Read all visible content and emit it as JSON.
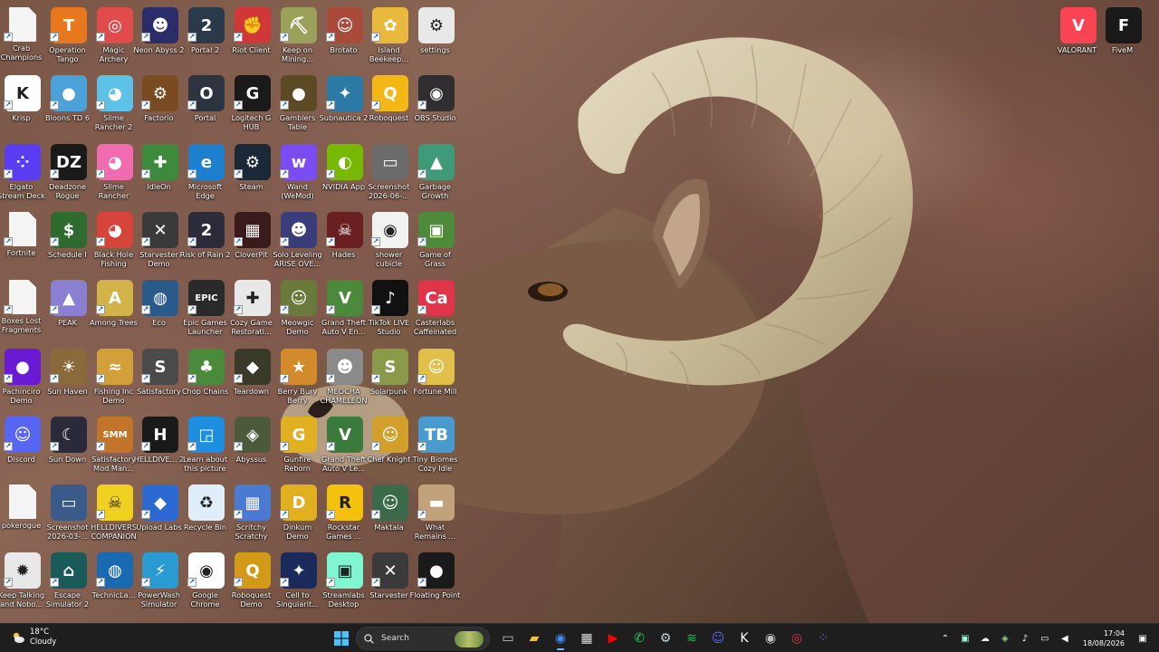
{
  "desktop_icons": [
    {
      "label": "Crab Champions",
      "icon": "file-icon",
      "bg": "file",
      "glyph": "",
      "shortcut": true
    },
    {
      "label": "Operation Tango",
      "icon": "operation-tango-icon",
      "bg": "#e8781e",
      "glyph": "T",
      "shortcut": true
    },
    {
      "label": "Magic Archery",
      "icon": "magic-archery-icon",
      "bg": "#e04b4b",
      "glyph": "◎",
      "shortcut": true
    },
    {
      "label": "Neon Abyss 2",
      "icon": "neon-abyss-icon",
      "bg": "#2b2d6b",
      "glyph": "☻",
      "shortcut": true
    },
    {
      "label": "Portal 2",
      "icon": "portal-2-icon",
      "bg": "#2a3a4a",
      "glyph": "2",
      "shortcut": true
    },
    {
      "label": "Riot Client",
      "icon": "riot-client-icon",
      "bg": "#d13639",
      "glyph": "✊",
      "shortcut": true
    },
    {
      "label": "Keep on Mining...",
      "icon": "keep-on-mining-icon",
      "bg": "#9aa15a",
      "glyph": "⛏",
      "shortcut": true
    },
    {
      "label": "Brotato",
      "icon": "brotato-icon",
      "bg": "#a94a3b",
      "glyph": "☺",
      "shortcut": true
    },
    {
      "label": "Island Beekeep...",
      "icon": "island-beekeeper-icon",
      "bg": "#e9b93d",
      "glyph": "✿",
      "shortcut": true
    },
    {
      "label": "settings",
      "icon": "settings-file-icon",
      "bg": "#e8e8e8",
      "glyph": "⚙",
      "shortcut": false
    },
    {
      "label": "Krisp",
      "icon": "krisp-icon",
      "bg": "#ffffff",
      "glyph": "K",
      "shortcut": true
    },
    {
      "label": "Bloons TD 6",
      "icon": "bloons-icon",
      "bg": "#4aa2d8",
      "glyph": "●",
      "shortcut": true
    },
    {
      "label": "Slime Rancher 2",
      "icon": "slime-rancher-2-icon",
      "bg": "#5ec1e7",
      "glyph": "◕",
      "shortcut": true
    },
    {
      "label": "Factorio",
      "icon": "factorio-icon",
      "bg": "#7a4a20",
      "glyph": "⚙",
      "shortcut": true
    },
    {
      "label": "Portal",
      "icon": "portal-icon",
      "bg": "#2c3440",
      "glyph": "O",
      "shortcut": true
    },
    {
      "label": "Logitech G HUB",
      "icon": "logitech-icon",
      "bg": "#1a1a1a",
      "glyph": "G",
      "shortcut": true
    },
    {
      "label": "Gamblers Table",
      "icon": "gamblers-table-icon",
      "bg": "#5b4a23",
      "glyph": "●",
      "shortcut": true
    },
    {
      "label": "Subnautica 2",
      "icon": "subnautica-icon",
      "bg": "#2b7aa6",
      "glyph": "✦",
      "shortcut": true
    },
    {
      "label": "Roboquest",
      "icon": "roboquest-icon",
      "bg": "#f3b716",
      "glyph": "Q",
      "shortcut": true
    },
    {
      "label": "OBS Studio",
      "icon": "obs-icon",
      "bg": "#302e31",
      "glyph": "◉",
      "shortcut": true
    },
    {
      "label": "Elgato Stream Deck",
      "icon": "stream-deck-icon",
      "bg": "#5a3df2",
      "glyph": "⁘",
      "shortcut": true
    },
    {
      "label": "Deadzone Rogue",
      "icon": "deadzone-icon",
      "bg": "#1a1a1a",
      "glyph": "DZ",
      "shortcut": true
    },
    {
      "label": "Slime Rancher",
      "icon": "slime-rancher-icon",
      "bg": "#f06bb0",
      "glyph": "◕",
      "shortcut": true
    },
    {
      "label": "IdleOn",
      "icon": "idleon-icon",
      "bg": "#3c8a3c",
      "glyph": "✚",
      "shortcut": true
    },
    {
      "label": "Microsoft Edge",
      "icon": "edge-icon",
      "bg": "#1e7fcf",
      "glyph": "e",
      "shortcut": true
    },
    {
      "label": "Steam",
      "icon": "steam-icon",
      "bg": "#1b2838",
      "glyph": "⚙",
      "shortcut": true
    },
    {
      "label": "Wand (WeMod)",
      "icon": "wand-icon",
      "bg": "#7a4cf2",
      "glyph": "w",
      "shortcut": true
    },
    {
      "label": "NVIDIA App",
      "icon": "nvidia-icon",
      "bg": "#76b900",
      "glyph": "◐",
      "shortcut": true
    },
    {
      "label": "Screenshot 2026-06-...",
      "icon": "screenshot-icon",
      "bg": "#6b6b6b",
      "glyph": "▭",
      "shortcut": false
    },
    {
      "label": "Garbage Growth",
      "icon": "garbage-growth-icon",
      "bg": "#3f9a7a",
      "glyph": "▲",
      "shortcut": true
    },
    {
      "label": "Fortnite",
      "icon": "file-icon",
      "bg": "file",
      "glyph": "",
      "shortcut": true
    },
    {
      "label": "Schedule I",
      "icon": "schedule-i-icon",
      "bg": "#2f6b2f",
      "glyph": "$",
      "shortcut": true
    },
    {
      "label": "Black Hole Fishing",
      "icon": "black-hole-fishing-icon",
      "bg": "#d6443a",
      "glyph": "◕",
      "shortcut": true
    },
    {
      "label": "Starvester Demo",
      "icon": "starvester-icon",
      "bg": "#3a3a3a",
      "glyph": "✕",
      "shortcut": true
    },
    {
      "label": "Risk of Rain 2",
      "icon": "risk-of-rain-icon",
      "bg": "#2b2b3a",
      "glyph": "2",
      "shortcut": true
    },
    {
      "label": "CloverPit",
      "icon": "cloverpit-icon",
      "bg": "#3a1a1a",
      "glyph": "▦",
      "shortcut": true
    },
    {
      "label": "Solo Leveling ARISE OVE...",
      "icon": "solo-leveling-icon",
      "bg": "#3a3d7a",
      "glyph": "☻",
      "shortcut": true
    },
    {
      "label": "Hades",
      "icon": "hades-icon",
      "bg": "#6a2020",
      "glyph": "☠",
      "shortcut": true
    },
    {
      "label": "shower cubicle",
      "icon": "chrome-shortcut-icon",
      "bg": "#f2f2f2",
      "glyph": "◉",
      "shortcut": true
    },
    {
      "label": "Game of Grass",
      "icon": "game-of-grass-icon",
      "bg": "#4d8a3a",
      "glyph": "▣",
      "shortcut": true
    },
    {
      "label": "Boxes Lost Fragments",
      "icon": "file-icon",
      "bg": "file",
      "glyph": "",
      "shortcut": true
    },
    {
      "label": "PEAK",
      "icon": "peak-icon",
      "bg": "#8a7fd1",
      "glyph": "▲",
      "shortcut": true
    },
    {
      "label": "Among Trees",
      "icon": "among-trees-icon",
      "bg": "#d2b34a",
      "glyph": "A",
      "shortcut": true
    },
    {
      "label": "Eco",
      "icon": "eco-icon",
      "bg": "#2a5a8a",
      "glyph": "◍",
      "shortcut": true
    },
    {
      "label": "Epic Games Launcher",
      "icon": "epic-games-icon",
      "bg": "#2a2a2a",
      "glyph": "EPIC",
      "shortcut": true
    },
    {
      "label": "Cozy Game Restorati...",
      "icon": "cozy-game-icon",
      "bg": "#e8e8e8",
      "glyph": "✚",
      "shortcut": true
    },
    {
      "label": "Meowgic Demo",
      "icon": "meowgic-icon",
      "bg": "#6a7a3a",
      "glyph": "☺",
      "shortcut": true
    },
    {
      "label": "Grand Theft Auto V En...",
      "icon": "gta-v-icon",
      "bg": "#4a8a3a",
      "glyph": "V",
      "shortcut": true
    },
    {
      "label": "TikTok LIVE Studio",
      "icon": "tiktok-icon",
      "bg": "#111111",
      "glyph": "♪",
      "shortcut": true
    },
    {
      "label": "Casterlabs Caffeinated",
      "icon": "casterlabs-icon",
      "bg": "#e0344a",
      "glyph": "Ca",
      "shortcut": true
    },
    {
      "label": "Pachinciro Demo",
      "icon": "pachinciro-icon",
      "bg": "#6a1ad2",
      "glyph": "●",
      "shortcut": true
    },
    {
      "label": "Sun Haven",
      "icon": "sun-haven-icon",
      "bg": "#8a6a3a",
      "glyph": "☀",
      "shortcut": true
    },
    {
      "label": "Fishing Inc Demo",
      "icon": "fishing-inc-icon",
      "bg": "#d2a03a",
      "glyph": "≈",
      "shortcut": true
    },
    {
      "label": "Satisfactory",
      "icon": "satisfactory-icon",
      "bg": "#4a4a4a",
      "glyph": "S",
      "shortcut": true
    },
    {
      "label": "Chop Chains",
      "icon": "chop-chains-icon",
      "bg": "#4a8a3a",
      "glyph": "♣",
      "shortcut": true
    },
    {
      "label": "Teardown",
      "icon": "teardown-icon",
      "bg": "#3a3a2a",
      "glyph": "◆",
      "shortcut": true
    },
    {
      "label": "Berry Bury Berry",
      "icon": "berry-bury-icon",
      "bg": "#d28a2a",
      "glyph": "★",
      "shortcut": true
    },
    {
      "label": "MEOCHA CHAMELEON",
      "icon": "meocha-icon",
      "bg": "#8a8a8a",
      "glyph": "☻",
      "shortcut": true
    },
    {
      "label": "Solarpunk",
      "icon": "solarpunk-icon",
      "bg": "#8a9a4a",
      "glyph": "S",
      "shortcut": true
    },
    {
      "label": "Fortune Mill",
      "icon": "fortune-mill-icon",
      "bg": "#e0c04a",
      "glyph": "☺",
      "shortcut": true
    },
    {
      "label": "Discord",
      "icon": "discord-icon",
      "bg": "#5865f2",
      "glyph": "☺",
      "shortcut": true
    },
    {
      "label": "Sun Down",
      "icon": "sun-down-icon",
      "bg": "#2a2a3a",
      "glyph": "☾",
      "shortcut": true
    },
    {
      "label": "Satisfactory Mod Man...",
      "icon": "smm-icon",
      "bg": "#c2752a",
      "glyph": "SMM",
      "shortcut": true
    },
    {
      "label": "HELLDIVE... 2",
      "icon": "helldivers-2-icon",
      "bg": "#1a1a1a",
      "glyph": "H",
      "shortcut": true
    },
    {
      "label": "Learn about this picture",
      "icon": "learn-picture-icon",
      "bg": "#1e8ee0",
      "glyph": "◲",
      "shortcut": true
    },
    {
      "label": "Abyssus",
      "icon": "abyssus-icon",
      "bg": "#4a5a3a",
      "glyph": "◈",
      "shortcut": true
    },
    {
      "label": "Gunfire Reborn",
      "icon": "gunfire-reborn-icon",
      "bg": "#e0b020",
      "glyph": "G",
      "shortcut": true
    },
    {
      "label": "Grand Theft Auto V Le...",
      "icon": "gta-v-legacy-icon",
      "bg": "#3a7a3a",
      "glyph": "V",
      "shortcut": true
    },
    {
      "label": "Chef Knight",
      "icon": "chef-knight-icon",
      "bg": "#d2a02a",
      "glyph": "☺",
      "shortcut": true
    },
    {
      "label": "Tiny Biomes Cozy Idle",
      "icon": "tiny-biomes-icon",
      "bg": "#4a9ad2",
      "glyph": "TB",
      "shortcut": true
    },
    {
      "label": "pokerogue",
      "icon": "file-icon",
      "bg": "file",
      "glyph": "",
      "shortcut": false
    },
    {
      "label": "Screenshot 2026-03-...",
      "icon": "screenshot-2-icon",
      "bg": "#3a5a8a",
      "glyph": "▭",
      "shortcut": false
    },
    {
      "label": "HELLDIVERS COMPANION",
      "icon": "helldivers-companion-icon",
      "bg": "#f0d020",
      "glyph": "☠",
      "shortcut": true
    },
    {
      "label": "Upload Labs",
      "icon": "upload-labs-icon",
      "bg": "#2a6ad2",
      "glyph": "◆",
      "shortcut": true
    },
    {
      "label": "Recycle Bin",
      "icon": "recycle-bin-icon",
      "bg": "#dfeef8",
      "glyph": "♻",
      "shortcut": false
    },
    {
      "label": "Scritchy Scratchy",
      "icon": "scritchy-scratchy-icon",
      "bg": "#4a7ad2",
      "glyph": "▦",
      "shortcut": true
    },
    {
      "label": "Dinkum Demo",
      "icon": "dinkum-icon",
      "bg": "#e0b020",
      "glyph": "D",
      "shortcut": true
    },
    {
      "label": "Rockstar Games ...",
      "icon": "rockstar-icon",
      "bg": "#f4c20d",
      "glyph": "R",
      "shortcut": true
    },
    {
      "label": "Maktala",
      "icon": "maktala-icon",
      "bg": "#3a6a4a",
      "glyph": "☺",
      "shortcut": true
    },
    {
      "label": "What Remains ...",
      "icon": "what-remains-icon",
      "bg": "#c2a27a",
      "glyph": "▬",
      "shortcut": true
    },
    {
      "label": "Keep Talking and Nobo...",
      "icon": "keep-talking-icon",
      "bg": "#e8e8e8",
      "glyph": "✹",
      "shortcut": true
    },
    {
      "label": "Escape Simulator 2",
      "icon": "escape-simulator-icon",
      "bg": "#1a5a5a",
      "glyph": "⌂",
      "shortcut": true
    },
    {
      "label": "TechnicLa...",
      "icon": "technic-launcher-icon",
      "bg": "#1a6ab2",
      "glyph": "◍",
      "shortcut": true
    },
    {
      "label": "PowerWash Simulator",
      "icon": "powerwash-icon",
      "bg": "#2a9ad2",
      "glyph": "⚡",
      "shortcut": true
    },
    {
      "label": "Google Chrome",
      "icon": "chrome-icon",
      "bg": "#ffffff",
      "glyph": "◉",
      "shortcut": true
    },
    {
      "label": "Roboquest Demo",
      "icon": "roboquest-demo-icon",
      "bg": "#d29a16",
      "glyph": "Q",
      "shortcut": true
    },
    {
      "label": "Cell to Singularit...",
      "icon": "cell-to-singularity-icon",
      "bg": "#1a2a5a",
      "glyph": "✦",
      "shortcut": true
    },
    {
      "label": "Streamlabs Desktop",
      "icon": "streamlabs-icon",
      "bg": "#80f5d2",
      "glyph": "▣",
      "shortcut": true
    },
    {
      "label": "Starvester",
      "icon": "starvester-2-icon",
      "bg": "#3a3a3a",
      "glyph": "✕",
      "shortcut": true
    },
    {
      "label": "Floating Point",
      "icon": "floating-point-icon",
      "bg": "#1a1a1a",
      "glyph": "●",
      "shortcut": true
    }
  ],
  "right_icons": [
    {
      "label": "VALORANT",
      "icon": "valorant-icon",
      "bg": "#fa4454",
      "glyph": "V"
    },
    {
      "label": "FiveM",
      "icon": "fivem-icon",
      "bg": "#1a1a1a",
      "glyph": "F"
    }
  ],
  "taskbar": {
    "weather": {
      "temp": "18°C",
      "condition": "Cloudy"
    },
    "search_placeholder": "Search",
    "apps": [
      {
        "name": "task-view-icon",
        "glyph": "▭",
        "color": "#cfcfcf"
      },
      {
        "name": "file-explorer-icon",
        "glyph": "▰",
        "color": "#f4c430"
      },
      {
        "name": "chrome-taskbar-icon",
        "glyph": "◉",
        "color": "#4285f4",
        "active": true
      },
      {
        "name": "store-icon",
        "glyph": "▦",
        "color": "#e0e0e0"
      },
      {
        "name": "youtube-icon",
        "glyph": "▶",
        "color": "#ff0000"
      },
      {
        "name": "whatsapp-icon",
        "glyph": "✆",
        "color": "#25d366"
      },
      {
        "name": "steam-taskbar-icon",
        "glyph": "⚙",
        "color": "#c7d5e0"
      },
      {
        "name": "spotify-icon",
        "glyph": "≋",
        "color": "#1db954"
      },
      {
        "name": "discord-taskbar-icon",
        "glyph": "☺",
        "color": "#5865f2"
      },
      {
        "name": "krisp-taskbar-icon",
        "glyph": "K",
        "color": "#ffffff"
      },
      {
        "name": "obs-taskbar-icon",
        "glyph": "◉",
        "color": "#bdbdbd"
      },
      {
        "name": "casterlabs-taskbar-icon",
        "glyph": "◎",
        "color": "#e0344a"
      },
      {
        "name": "stream-deck-taskbar-icon",
        "glyph": "⁘",
        "color": "#7a5df2"
      }
    ],
    "clock": {
      "time": "17:04",
      "date": "18/08/2026"
    }
  },
  "colors": {
    "taskbar": "#1e1e1e",
    "accent": "#7eb6ff"
  }
}
